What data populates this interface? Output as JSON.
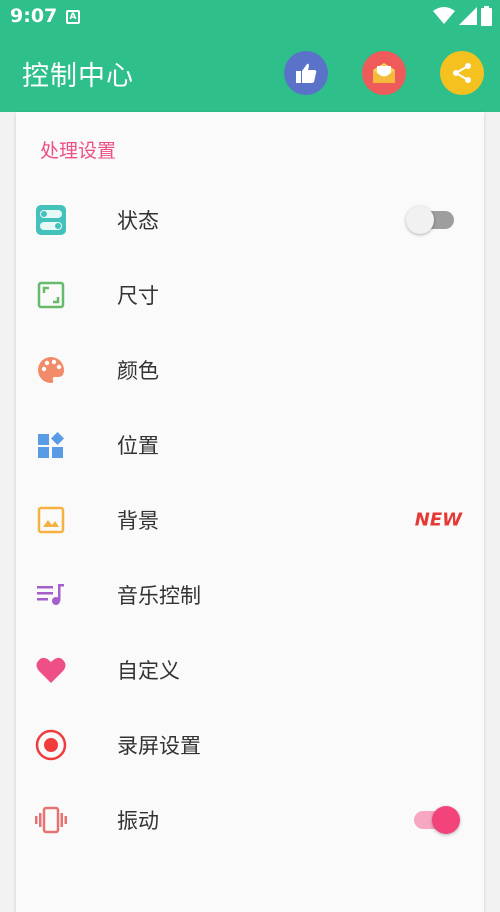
{
  "status_bar": {
    "time": "9:07",
    "notification_letter": "A"
  },
  "app_bar": {
    "title": "控制中心",
    "actions": [
      {
        "name": "like",
        "color": "#5a73c8"
      },
      {
        "name": "mail",
        "color": "#ef5a5a"
      },
      {
        "name": "share",
        "color": "#f5c11f"
      }
    ]
  },
  "settings": {
    "section_title": "处理设置",
    "items": [
      {
        "label": "状态",
        "icon": "toggle-icon",
        "trailing": "switch",
        "switch_on": false
      },
      {
        "label": "尺寸",
        "icon": "resize-icon"
      },
      {
        "label": "颜色",
        "icon": "palette-icon"
      },
      {
        "label": "位置",
        "icon": "widgets-icon"
      },
      {
        "label": "背景",
        "icon": "image-icon",
        "badge": "NEW"
      },
      {
        "label": "音乐控制",
        "icon": "music-queue-icon"
      },
      {
        "label": "自定义",
        "icon": "heart-icon"
      },
      {
        "label": "录屏设置",
        "icon": "record-icon"
      },
      {
        "label": "振动",
        "icon": "vibration-icon",
        "trailing": "switch",
        "switch_on": true
      }
    ]
  },
  "colors": {
    "primary": "#2fbf8a",
    "accent": "#ee4f87"
  }
}
